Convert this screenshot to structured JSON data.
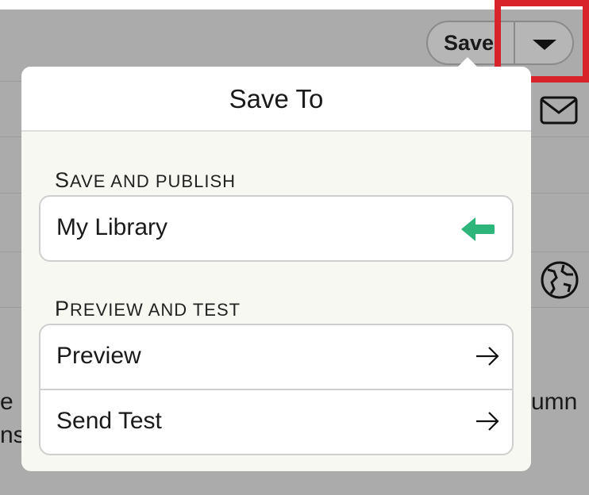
{
  "toolbar": {
    "save_label": "Save"
  },
  "background_text": {
    "left_fragment_1": "e",
    "left_fragment_2": "ns",
    "right_fragment": "umn"
  },
  "popover": {
    "title": "Save To",
    "sections": [
      {
        "label": "Save and Publish",
        "items": [
          {
            "label": "My Library",
            "icon": "green-arrow-left-icon"
          }
        ]
      },
      {
        "label": "Preview and Test",
        "items": [
          {
            "label": "Preview",
            "icon": "arrow-right-icon"
          },
          {
            "label": "Send Test",
            "icon": "arrow-right-icon"
          }
        ]
      }
    ]
  },
  "colors": {
    "overlay": "#ababab",
    "highlight": "#d8232a",
    "accent_green": "#2db57a",
    "popover_bg": "#f8f8f3"
  }
}
